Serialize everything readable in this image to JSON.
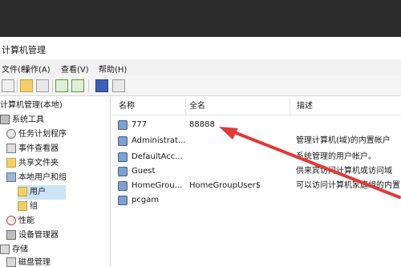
{
  "window": {
    "title": "计算机管理"
  },
  "menu": [
    "文件(F)",
    "操作(A)",
    "查看(V)",
    "帮助(H)"
  ],
  "toolbar": {
    "icons": [
      "back-arrow-icon",
      "forward-arrow-icon",
      "up-folder-icon",
      "show-tree-icon",
      "refresh-icon",
      "export-icon",
      "help-icon",
      "properties-icon"
    ]
  },
  "tree": {
    "items": [
      {
        "label": "计算机管理(本地)",
        "icon": "computer-icon"
      },
      {
        "label": "系统工具",
        "icon": "tools-icon"
      },
      {
        "label": "任务计划程序",
        "icon": "clock-icon"
      },
      {
        "label": "事件查看器",
        "icon": "event-viewer-icon"
      },
      {
        "label": "共享文件夹",
        "icon": "shared-folder-icon"
      },
      {
        "label": "本地用户和组",
        "icon": "users-group-icon"
      },
      {
        "label": "用户",
        "icon": "folder-icon"
      },
      {
        "label": "组",
        "icon": "folder-icon"
      },
      {
        "label": "性能",
        "icon": "performance-icon"
      },
      {
        "label": "设备管理器",
        "icon": "device-manager-icon"
      },
      {
        "label": "存储",
        "icon": "storage-icon"
      },
      {
        "label": "磁盘管理",
        "icon": "disk-icon"
      }
    ]
  },
  "list": {
    "columns": [
      "名称",
      "全名",
      "描述"
    ],
    "rows": [
      {
        "name": "777",
        "fullname": "88888",
        "desc": ""
      },
      {
        "name": "Administrat...",
        "fullname": "",
        "desc": "管理计算机(域)的内置帐户"
      },
      {
        "name": "DefaultAcc...",
        "fullname": "",
        "desc": "系统管理的用户帐户。"
      },
      {
        "name": "Guest",
        "fullname": "",
        "desc": "供来宾访问计算机或访问域"
      },
      {
        "name": "HomeGrou...",
        "fullname": "HomeGroupUser$",
        "desc": "可以访问计算机家庭组的内置"
      },
      {
        "name": "pcgam",
        "fullname": "",
        "desc": ""
      }
    ]
  },
  "colors": {
    "annotation_arrow": "#e03a3a",
    "selection": "#cce4f7"
  }
}
